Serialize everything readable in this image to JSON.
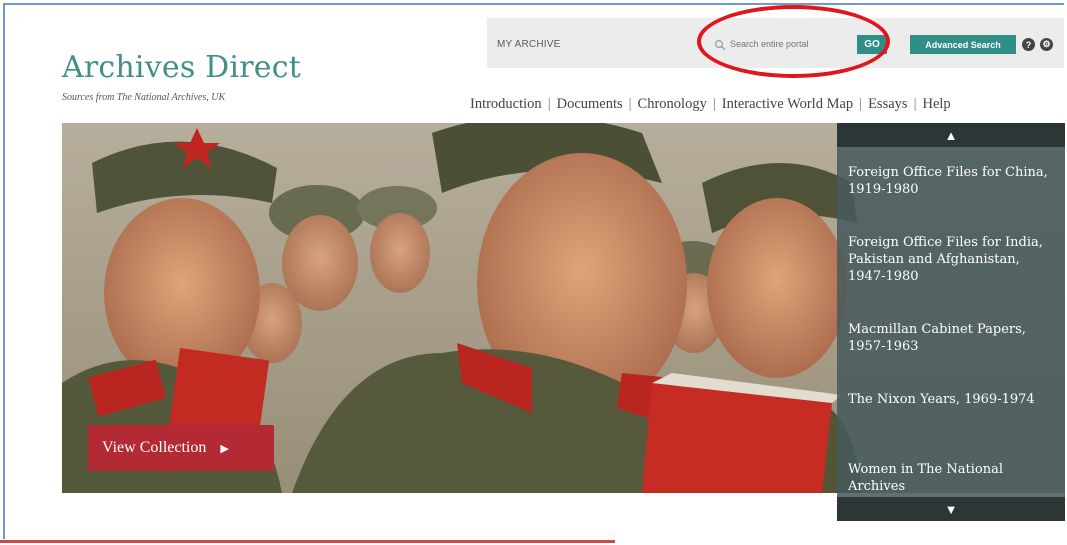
{
  "header": {
    "logo_title": "Archives Direct",
    "logo_subtitle": "Sources from The National Archives, UK"
  },
  "topbar": {
    "my_archive": "MY ARCHIVE",
    "search_placeholder": "Search entire portal",
    "go_label": "GO",
    "advanced_search_label": "Advanced Search",
    "help_icon": "?",
    "settings_icon": "⚙"
  },
  "nav": {
    "items": [
      {
        "label": "Introduction"
      },
      {
        "label": "Documents"
      },
      {
        "label": "Chronology"
      },
      {
        "label": "Interactive World Map"
      },
      {
        "label": "Essays"
      },
      {
        "label": "Help"
      }
    ]
  },
  "hero": {
    "view_collection_label": "View Collection",
    "arrow": "▶"
  },
  "sidebar": {
    "up_arrow": "▲",
    "down_arrow": "▼",
    "items": [
      {
        "label": "Foreign Office Files for China, 1919-1980"
      },
      {
        "label": "Foreign Office Files for India, Pakistan and Afghanistan, 1947-1980"
      },
      {
        "label": "Macmillan Cabinet Papers, 1957-1963"
      },
      {
        "label": "The Nixon Years, 1969-1974"
      },
      {
        "label": "Women in The National Archives"
      }
    ]
  },
  "colors": {
    "brand_teal": "#3f8f8c",
    "button_teal": "#2f8f86",
    "cta_red": "#b32a35",
    "annotation_red": "#e0161c"
  }
}
